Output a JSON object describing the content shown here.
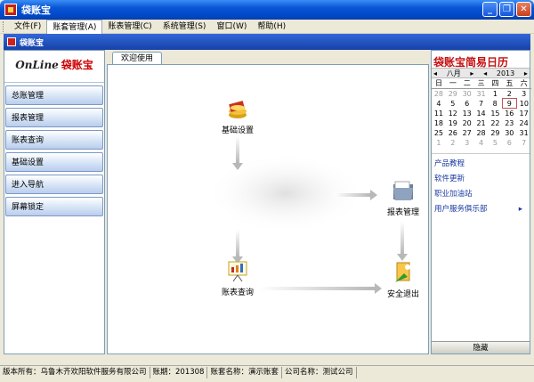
{
  "window": {
    "title": "袋账宝"
  },
  "menu": [
    {
      "label": "文件(F)"
    },
    {
      "label": "账套管理(A)"
    },
    {
      "label": "账表管理(C)"
    },
    {
      "label": "系统管理(S)"
    },
    {
      "label": "窗口(W)"
    },
    {
      "label": "帮助(H)"
    }
  ],
  "inner_title": "袋账宝",
  "brand": {
    "en": "OnLine",
    "cn": "袋账宝"
  },
  "nav": [
    "总账管理",
    "报表管理",
    "账表查询",
    "基础设置",
    "进入导航",
    "屏幕锁定"
  ],
  "tab": "欢迎使用",
  "flow": {
    "basic": "基础设置",
    "report": "报表管理",
    "query": "账表查询",
    "exit": "安全退出"
  },
  "calendar": {
    "title": "袋账宝简易日历",
    "month": "八月",
    "year": "2013",
    "weekdays": [
      "日",
      "一",
      "二",
      "三",
      "四",
      "五",
      "六"
    ],
    "weeks": [
      [
        "28",
        "29",
        "30",
        "31",
        "1",
        "2",
        "3"
      ],
      [
        "4",
        "5",
        "6",
        "7",
        "8",
        "9",
        "10"
      ],
      [
        "11",
        "12",
        "13",
        "14",
        "15",
        "16",
        "17"
      ],
      [
        "18",
        "19",
        "20",
        "21",
        "22",
        "23",
        "24"
      ],
      [
        "25",
        "26",
        "27",
        "28",
        "29",
        "30",
        "31"
      ],
      [
        "1",
        "2",
        "3",
        "4",
        "5",
        "6",
        "7"
      ]
    ],
    "today": "9"
  },
  "links": [
    "产品教程",
    "软件更新",
    "职业加油站",
    "用户服务俱乐部"
  ],
  "hide_label": "隐藏",
  "status": {
    "copyright": "版本所有：乌鲁木齐欢阳软件服务有限公司",
    "period": "账期：201308",
    "set_name": "账套名称：演示账套",
    "company": "公司名称：测试公司"
  }
}
